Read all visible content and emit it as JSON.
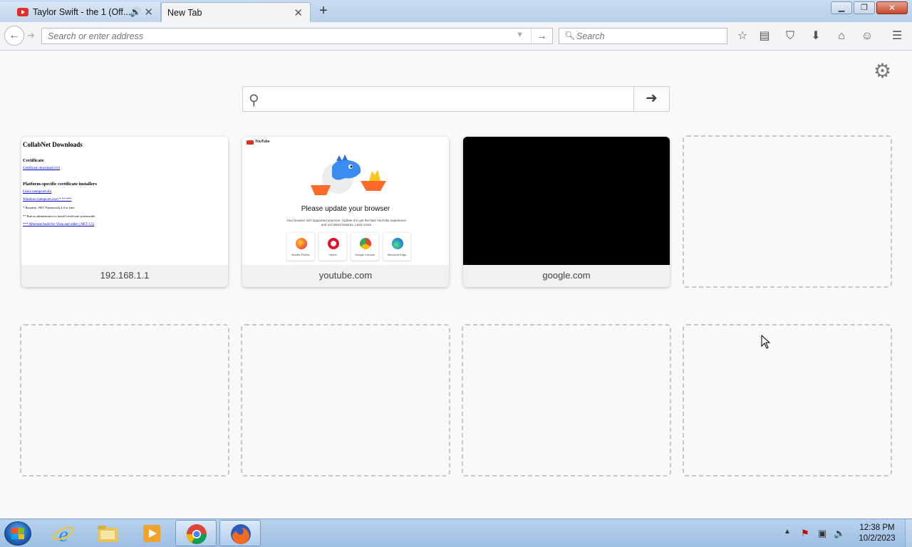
{
  "tabs": [
    {
      "title": "Taylor Swift - the 1 (Off...",
      "favicon": "youtube-icon",
      "audio": true,
      "active": false
    },
    {
      "title": "New Tab",
      "active": true
    }
  ],
  "window_controls": {
    "minimize": "minimize-icon",
    "restore": "restore-icon",
    "close": "close-icon"
  },
  "navbar": {
    "url_placeholder": "Search or enter address",
    "url_value": "",
    "search_placeholder": "Search"
  },
  "newtab": {
    "search_placeholder": "",
    "tiles": [
      {
        "caption": "192.168.1.1",
        "type": "collabnet"
      },
      {
        "caption": "youtube.com",
        "type": "youtube"
      },
      {
        "caption": "google.com",
        "type": "black"
      },
      {
        "caption": "",
        "type": "empty"
      },
      {
        "caption": "",
        "type": "empty"
      },
      {
        "caption": "",
        "type": "empty"
      },
      {
        "caption": "",
        "type": "empty"
      },
      {
        "caption": "",
        "type": "empty"
      }
    ]
  },
  "collabnet_thumb": {
    "title": "CollabNet Downloads",
    "cert_heading": "Certificate",
    "cert_link": "Certificate download (crt)",
    "platform_heading": "Platform-specific certificate installers",
    "linux_link": "Linux (setupcert.sh)",
    "windows_link": "Windows (setupcert.exe) * ** ***",
    "note1": "* Requires .NET Framework 4.0 or later",
    "note2": "** Run as administrator to install certificate systemwide",
    "note3": "*** Alternate build for Vista and older (.NET 3.5)"
  },
  "youtube_thumb": {
    "logo_text": "YouTube",
    "message": "Please update your browser",
    "subtext": "Your browser isn't supported anymore. Update it to get the best YouTube experience and our latest features. Learn more",
    "browsers": [
      "Mozilla Firefox",
      "Opera",
      "Google Chrome",
      "Microsoft Edge"
    ]
  },
  "taskbar": {
    "clock_time": "12:38 PM",
    "clock_date": "10/2/2023",
    "pinned": [
      "internet-explorer-icon",
      "file-explorer-icon",
      "media-player-icon",
      "chrome-icon",
      "firefox-icon"
    ]
  },
  "colors": {
    "accent_youtube": "#e52d27",
    "taskbar": "#9ebfe3",
    "content_bg": "#f9f9f9"
  }
}
